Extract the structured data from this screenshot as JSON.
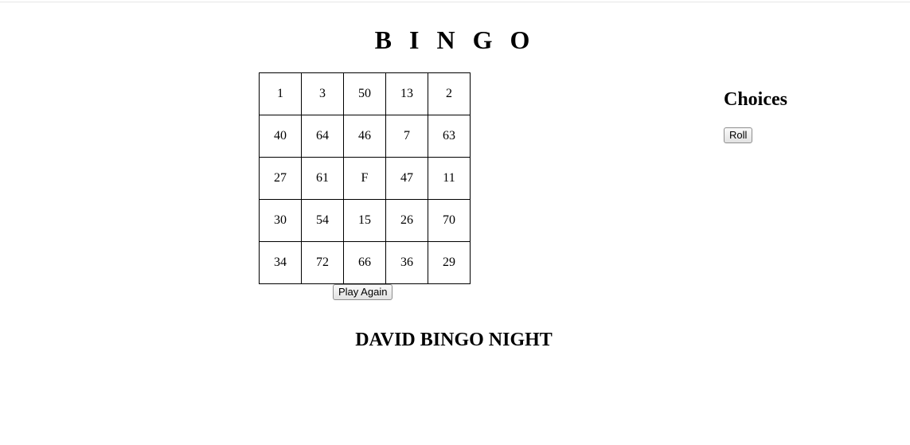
{
  "title": "B I N G O",
  "board": {
    "rows": [
      [
        "1",
        "3",
        "50",
        "13",
        "2"
      ],
      [
        "40",
        "64",
        "46",
        "7",
        "63"
      ],
      [
        "27",
        "61",
        "F",
        "47",
        "11"
      ],
      [
        "30",
        "54",
        "15",
        "26",
        "70"
      ],
      [
        "34",
        "72",
        "66",
        "36",
        "29"
      ]
    ]
  },
  "play_again_label": "Play Again",
  "choices": {
    "heading": "Choices",
    "roll_label": "Roll"
  },
  "footer": {
    "title": "DAVID BINGO NIGHT"
  }
}
